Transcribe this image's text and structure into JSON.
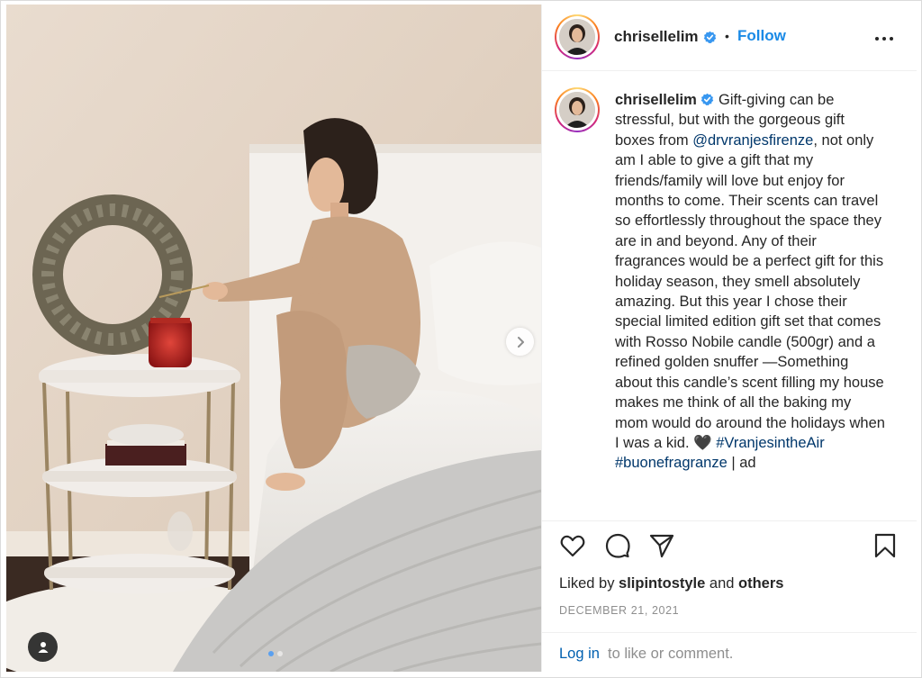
{
  "post": {
    "username": "chrisellelim",
    "follow_label": "Follow",
    "separator": "•",
    "caption_text": "Gift-giving can be stressful, but with the gorgeous gift boxes from ",
    "caption_mention": "@drvranjesfirenze",
    "caption_body": ", not only am I able to give a gift that my friends/family will love but enjoy for months to come. Their scents can travel so effortlessly throughout the space they are in and beyond. Any of their fragrances would be a perfect gift for this holiday season, they smell absolutely amazing. But this year I chose their special limited edition gift set that comes with Rosso Nobile candle (500gr) and a refined golden snuffer —Something about this candle’s scent filling my house makes me think of all the baking my mom would do around the holidays when I was a kid. 🖤 ",
    "hashtag_1": "#VranjesintheAir",
    "hashtag_2": "#buonefragranze",
    "caption_tail": " | ad",
    "likes_prefix": "Liked by ",
    "likes_user": "slipintostyle",
    "likes_and": " and ",
    "likes_others": "others",
    "date": "DECEMBER 21, 2021",
    "login_link": "Log in",
    "login_rest": "to like or comment."
  },
  "carousel": {
    "slide_count": 2,
    "current_slide": 1
  },
  "colors": {
    "link_blue": "#1a8ae6",
    "mention_blue": "#00376b",
    "verified_blue": "#3897f0",
    "muted": "#8e8e8e"
  },
  "icons": [
    "verified-badge-icon",
    "more-options-icon",
    "heart-icon",
    "comment-icon",
    "share-icon",
    "bookmark-icon",
    "chevron-right-icon",
    "user-tag-icon"
  ]
}
